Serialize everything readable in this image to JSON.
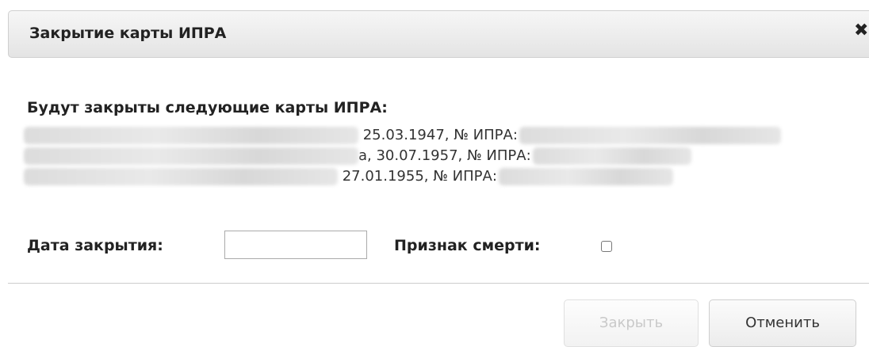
{
  "dialog": {
    "title": "Закрытие карты ИПРА",
    "close_glyph": "✖"
  },
  "content": {
    "heading": "Будут закрыты следующие карты ИПРА:",
    "cards": [
      {
        "text": " 25.03.1947, № ИПРА:"
      },
      {
        "text": "а, 30.07.1957, № ИПРА:"
      },
      {
        "text": " 27.01.1955, № ИПРА:"
      }
    ]
  },
  "form": {
    "date_label": "Дата закрытия:",
    "date_value": "",
    "death_label": "Признак смерти:",
    "death_checked": false
  },
  "buttons": {
    "close_label": "Закрыть",
    "cancel_label": "Отменить"
  }
}
